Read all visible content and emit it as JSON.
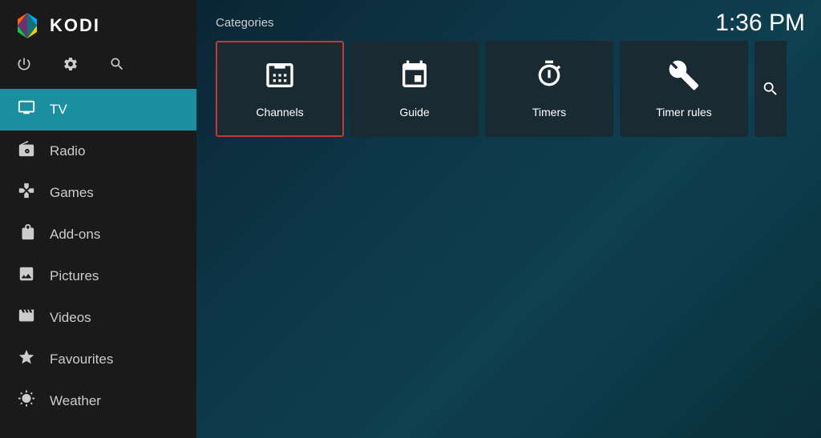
{
  "app": {
    "title": "KODI",
    "clock": "1:36 PM"
  },
  "sidebar": {
    "header_icon_power": "⏻",
    "header_icon_settings": "⚙",
    "header_icon_search": "🔍",
    "nav_items": [
      {
        "id": "tv",
        "label": "TV",
        "icon": "tv",
        "active": true
      },
      {
        "id": "radio",
        "label": "Radio",
        "icon": "radio"
      },
      {
        "id": "games",
        "label": "Games",
        "icon": "games"
      },
      {
        "id": "addons",
        "label": "Add-ons",
        "icon": "addons"
      },
      {
        "id": "pictures",
        "label": "Pictures",
        "icon": "pictures"
      },
      {
        "id": "videos",
        "label": "Videos",
        "icon": "videos"
      },
      {
        "id": "favourites",
        "label": "Favourites",
        "icon": "favourites"
      },
      {
        "id": "weather",
        "label": "Weather",
        "icon": "weather"
      }
    ]
  },
  "main": {
    "categories_label": "Categories",
    "categories": [
      {
        "id": "channels",
        "label": "Channels",
        "selected": true
      },
      {
        "id": "guide",
        "label": "Guide",
        "selected": false
      },
      {
        "id": "timers",
        "label": "Timers",
        "selected": false
      },
      {
        "id": "timer-rules",
        "label": "Timer rules",
        "selected": false
      },
      {
        "id": "search",
        "label": "Se…",
        "partial": true
      }
    ]
  }
}
